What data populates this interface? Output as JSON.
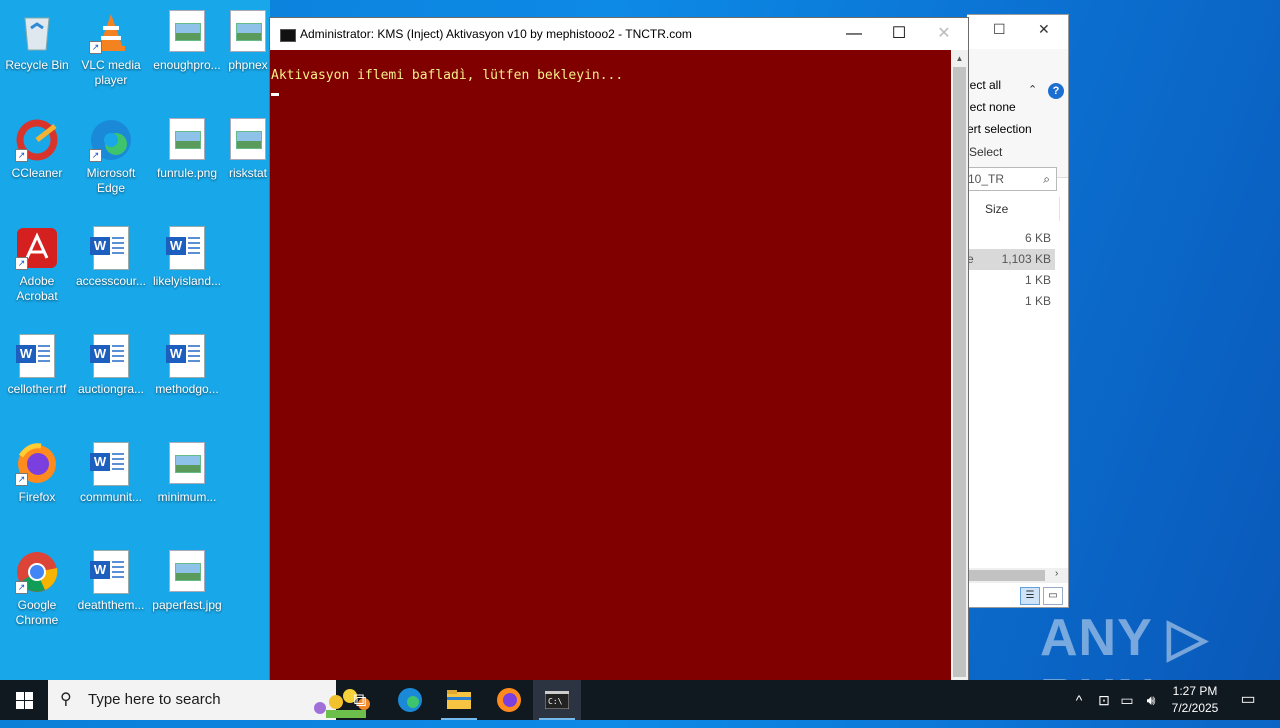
{
  "desktop": {
    "icons": [
      {
        "label": "Recycle Bin",
        "icon": "recycle-bin-icon"
      },
      {
        "label": "VLC media player",
        "icon": "vlc-icon"
      },
      {
        "label": "enoughpro...",
        "icon": "image-file-icon"
      },
      {
        "label": "phpnex",
        "icon": "image-file-icon"
      },
      {
        "label": "CCleaner",
        "icon": "ccleaner-icon"
      },
      {
        "label": "Microsoft Edge",
        "icon": "edge-icon"
      },
      {
        "label": "funrule.png",
        "icon": "image-file-icon"
      },
      {
        "label": "riskstat",
        "icon": "image-file-icon"
      },
      {
        "label": "Adobe Acrobat",
        "icon": "acrobat-icon"
      },
      {
        "label": "accesscour...",
        "icon": "word-document-icon"
      },
      {
        "label": "likelyisland...",
        "icon": "word-document-icon"
      },
      {
        "label": "cellother.rtf",
        "icon": "word-document-icon"
      },
      {
        "label": "auctiongra...",
        "icon": "word-document-icon"
      },
      {
        "label": "methodgo...",
        "icon": "word-document-icon"
      },
      {
        "label": "Firefox",
        "icon": "firefox-icon"
      },
      {
        "label": "communit...",
        "icon": "word-document-icon"
      },
      {
        "label": "minimum...",
        "icon": "image-file-icon"
      },
      {
        "label": "Google Chrome",
        "icon": "chrome-icon"
      },
      {
        "label": "deaththem...",
        "icon": "word-document-icon"
      },
      {
        "label": "paperfast.jpg",
        "icon": "image-file-icon"
      }
    ]
  },
  "console": {
    "title": "Administrator:  KMS (Inject) Aktivasyon v10 by mephistooo2 - TNCTR.com",
    "output_line": "Aktivasyon iflemi bafladì, lütfen bekleyin...",
    "background": "#800000",
    "text_color": "#f5f08a",
    "minimize": "—",
    "maximize": "☐",
    "close": "✕"
  },
  "explorer": {
    "ribbon": {
      "select_all": "lect all",
      "select_none": "lect none",
      "invert_selection": "ert selection",
      "select_group": "Select"
    },
    "search_value": "10_TR",
    "column_header": "Size",
    "rows": [
      {
        "size": "6 KB",
        "selected": false
      },
      {
        "size": "1,103 KB",
        "selected": true
      },
      {
        "size": "1 KB",
        "selected": false
      },
      {
        "size": "1 KB",
        "selected": false
      }
    ],
    "selected_row_prefix": "e"
  },
  "watermark": "ANY ▷ RUN",
  "taskbar": {
    "search_placeholder": "Type here to search",
    "time": "1:27 PM",
    "date": "7/2/2025",
    "apps": [
      "task-view",
      "edge",
      "file-explorer",
      "firefox",
      "cmd"
    ]
  }
}
